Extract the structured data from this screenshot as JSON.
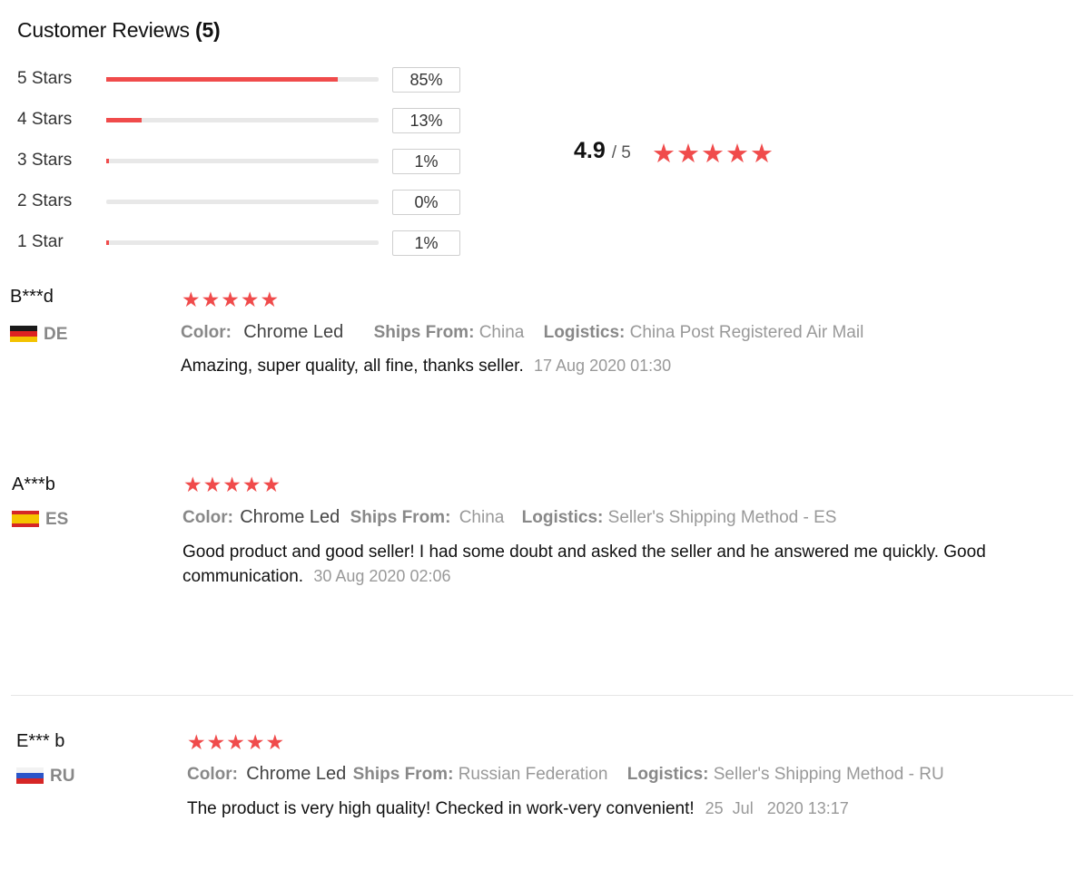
{
  "header": {
    "title": "Customer Reviews",
    "count": "(5)"
  },
  "histogram": [
    {
      "label": "5 Stars",
      "percent": "85%",
      "fill": 0.85
    },
    {
      "label": "4 Stars",
      "percent": "13%",
      "fill": 0.13
    },
    {
      "label": "3 Stars",
      "percent": "1%",
      "fill": 0.01
    },
    {
      "label": "2 Stars",
      "percent": "0%",
      "fill": 0.0
    },
    {
      "label": "1 Star",
      "percent": "1%",
      "fill": 0.01
    }
  ],
  "summary": {
    "average": "4.9",
    "out_of": "/ 5",
    "stars": 5
  },
  "star_color": "#f04b4b",
  "reviews": [
    {
      "name": "B***d",
      "country": "DE",
      "flag": "flag-de-icon",
      "stars": 5,
      "color_label": "Color:",
      "color_value": "Chrome Led",
      "ships_label": "Ships From:",
      "ships_value": "China",
      "logistics_label": "Logistics:",
      "logistics_value": "China Post Registered Air Mail",
      "text": "Amazing, super quality, all fine, thanks seller.",
      "date": "17 Aug 2020 01:30"
    },
    {
      "name": "A***b",
      "country": "ES",
      "flag": "flag-es-icon",
      "stars": 5,
      "color_label": "Color:",
      "color_value": "Chrome Led",
      "ships_label": "Ships From:",
      "ships_value": "China",
      "logistics_label": "Logistics:",
      "logistics_value": "Seller's Shipping Method - ES",
      "text": "Good product and good seller! I had some doubt and asked the seller and he answered me quickly. Good communication.",
      "date": "30 Aug 2020 02:06"
    },
    {
      "name": "E*** b",
      "country": "RU",
      "flag": "flag-ru-icon",
      "stars": 5,
      "color_label": "Color:",
      "color_value": "Chrome Led",
      "ships_label": "Ships From:",
      "ships_value": "Russian Federation",
      "logistics_label": "Logistics:",
      "logistics_value": "Seller's Shipping Method - RU",
      "text": "The product is very high quality! Checked in work-very convenient!",
      "date": "25  Jul   2020 13:17"
    }
  ]
}
